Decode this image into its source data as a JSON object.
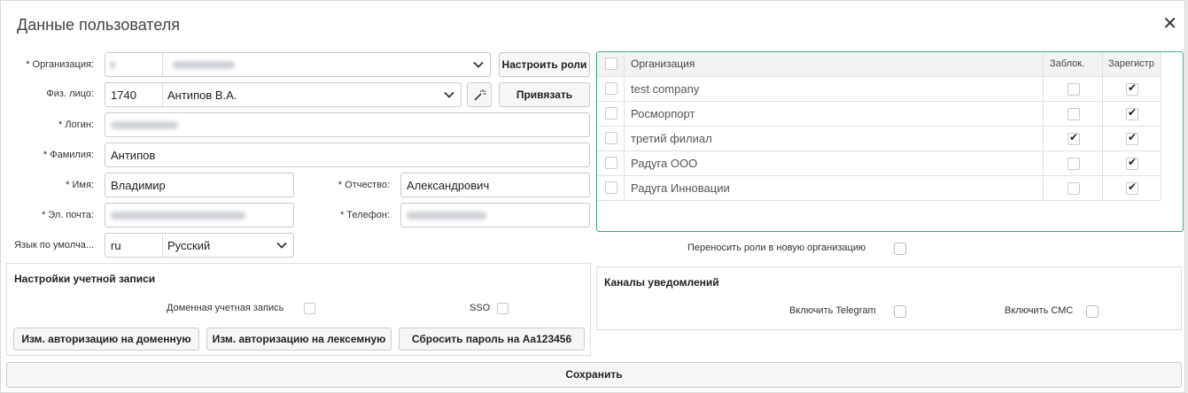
{
  "dialog": {
    "title": "Данные пользователя",
    "close_glyph": "✕"
  },
  "form": {
    "org_label": "* Организация:",
    "person_label": "Физ. лицо:",
    "person_code": "1740",
    "person_name": "Антипов В.А.",
    "login_label": "* Логин:",
    "surname_label": "* Фамилия:",
    "surname_value": "Антипов",
    "name_label": "* Имя:",
    "name_value": "Владимир",
    "patronymic_label": "* Отчество:",
    "patronymic_value": "Александрович",
    "email_label": "* Эл. почта:",
    "phone_label": "* Телефон:",
    "lang_label": "Язык по умолча...",
    "lang_code": "ru",
    "lang_name": "Русский"
  },
  "buttons": {
    "configure_roles": "Настроить роли",
    "bind": "Привязать",
    "to_domain": "Изм. авторизацию на доменную",
    "to_lexemny": "Изм. авторизацию на лексемную",
    "reset_password": "Сбросить пароль на Aa123456",
    "save": "Сохранить"
  },
  "org_grid": {
    "columns": [
      "Организация",
      "Заблок.",
      "Зарегистр"
    ],
    "rows": [
      {
        "name": "test company",
        "blocked": false,
        "registered": true
      },
      {
        "name": "Росморпорт",
        "blocked": false,
        "registered": true
      },
      {
        "name": "третий филиал",
        "blocked": true,
        "registered": true
      },
      {
        "name": "Радуга ООО",
        "blocked": false,
        "registered": true
      },
      {
        "name": "Радуга Инновации",
        "blocked": false,
        "registered": true
      }
    ]
  },
  "transfer_roles": {
    "label": "Переносить роли в новую организацию",
    "checked": false
  },
  "account_settings": {
    "title": "Настройки учетной записи",
    "domain_label": "Доменная учетная запись",
    "domain_checked": false,
    "sso_label": "SSO",
    "sso_checked": false
  },
  "notifications": {
    "title": "Каналы уведомлений",
    "telegram_label": "Включить Telegram",
    "telegram_checked": false,
    "sms_label": "Включить СМС",
    "sms_checked": false
  },
  "icons": {
    "chevron": "chevron-down-icon",
    "wand": "magic-wand-icon",
    "close": "close-icon",
    "check": "✔"
  },
  "colors": {
    "grid_border": "#3daa88"
  }
}
